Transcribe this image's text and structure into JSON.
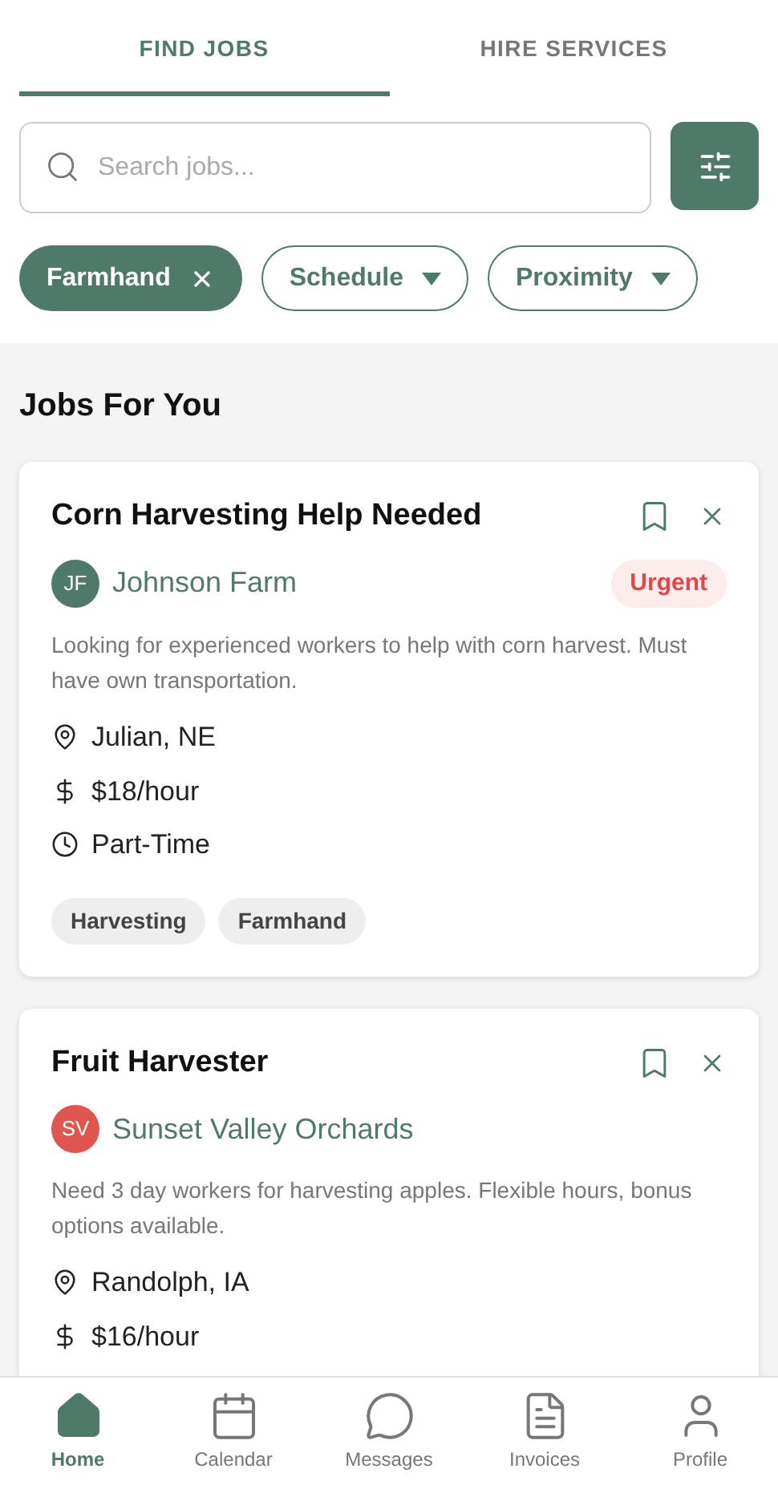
{
  "tabs": [
    {
      "label": "FIND JOBS",
      "selected": true
    },
    {
      "label": "HIRE SERVICES",
      "selected": false
    }
  ],
  "search": {
    "placeholder": "Search jobs..."
  },
  "filters": [
    {
      "label": "Farmhand",
      "kind": "removable",
      "selected": true
    },
    {
      "label": "Schedule",
      "kind": "dropdown",
      "selected": false
    },
    {
      "label": "Proximity",
      "kind": "dropdown",
      "selected": false
    }
  ],
  "section_title": "Jobs For You",
  "jobs": [
    {
      "title": "Corn Harvesting Help Needed",
      "initials": "JF",
      "company": "Johnson Farm",
      "color": "#4f7a6a",
      "badge": "Urgent",
      "description": "Looking for experienced workers to help with corn harvest. Must have own transportation.",
      "details": [
        {
          "kind": "location",
          "text": "Julian, NE"
        },
        {
          "kind": "pay",
          "text": "$18/hour"
        },
        {
          "kind": "schedule",
          "text": "Part-Time"
        }
      ],
      "tags": [
        "Harvesting",
        "Farmhand"
      ]
    },
    {
      "title": "Fruit Harvester",
      "initials": "SV",
      "company": "Sunset Valley Orchards",
      "color": "#e0554d",
      "description": "Need 3 day workers for harvesting apples. Flexible hours, bonus options available.",
      "details": [
        {
          "kind": "location",
          "text": "Randolph, IA"
        },
        {
          "kind": "pay",
          "text": "$16/hour"
        }
      ]
    }
  ],
  "nav": [
    {
      "label": "Home",
      "kind": "home",
      "selected": true
    },
    {
      "label": "Calendar",
      "kind": "calendar",
      "selected": false
    },
    {
      "label": "Messages",
      "kind": "messages",
      "selected": false
    },
    {
      "label": "Invoices",
      "kind": "invoices",
      "selected": false
    },
    {
      "label": "Profile",
      "kind": "profile",
      "selected": false
    }
  ]
}
